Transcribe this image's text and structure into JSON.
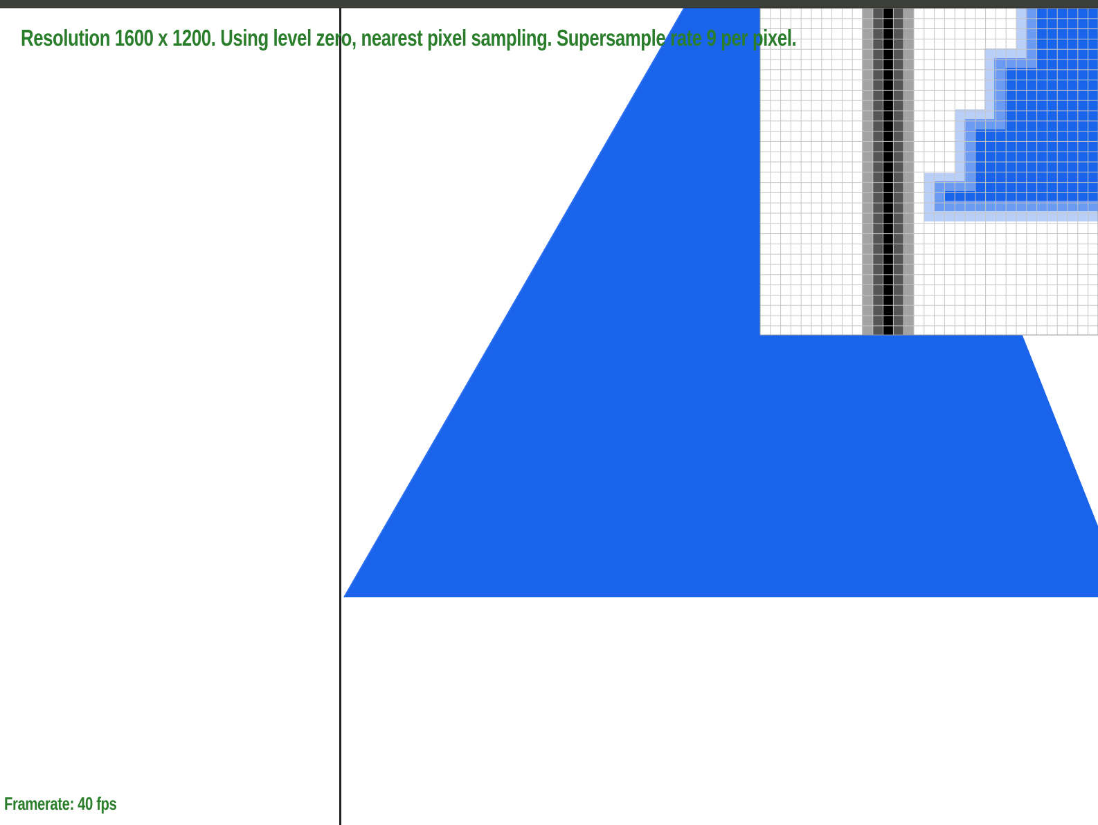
{
  "window": {
    "titlebar_color": "#3d3f3b"
  },
  "overlay": {
    "status_text": "Resolution 1600 x 1200. Using level zero, nearest pixel sampling. Supersample rate 9 per pixel.",
    "framerate_text": "Framerate: 40 fps",
    "text_color": "#2a7d2a"
  },
  "scene": {
    "shape": "blue-triangle",
    "fill_color": "#1a64eb",
    "line_color": "#1a1a1a",
    "zoom_inset": {
      "description_icon": "pixel-inspector-zoom",
      "grid_color": "#bfbfbf"
    }
  }
}
